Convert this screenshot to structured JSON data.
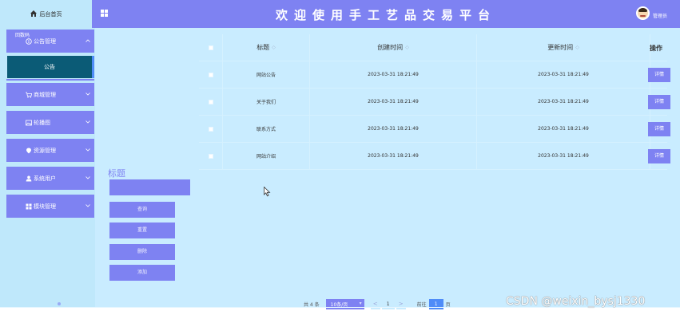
{
  "header": {
    "home_label": "后台首页",
    "title": "欢迎使用手工艺品交易平台",
    "admin_name": "管理员"
  },
  "sidebar": {
    "badge": "回数码",
    "items": [
      {
        "label": "公告管理",
        "icon": "info-circle-icon",
        "arrow": "^"
      },
      {
        "label": "商城管理",
        "icon": "cart-icon",
        "arrow": "v"
      },
      {
        "label": "轮播图",
        "icon": "picture-icon",
        "arrow": "v"
      },
      {
        "label": "资源管理",
        "icon": "location-pin-icon",
        "arrow": "v"
      },
      {
        "label": "系统用户",
        "icon": "user-icon",
        "arrow": "v"
      },
      {
        "label": "模块管理",
        "icon": "grid-icon",
        "arrow": "v"
      }
    ],
    "submenu": {
      "label": "公告"
    }
  },
  "search": {
    "label": "标题",
    "input_value": "",
    "buttons": {
      "query": "查询",
      "reset": "重置",
      "delete": "删除",
      "add": "添加"
    }
  },
  "table": {
    "headers": {
      "title": "标题",
      "created": "创建时间",
      "updated": "更新时间",
      "operation": "操作"
    },
    "sort_glyph": "◇",
    "detail_label": "详情",
    "rows": [
      {
        "title": "网站公告",
        "created": "2023-03-31 18:21:49",
        "updated": "2023-03-31 18:21:49"
      },
      {
        "title": "关于我们",
        "created": "2023-03-31 18:21:49",
        "updated": "2023-03-31 18:21:49"
      },
      {
        "title": "联系方式",
        "created": "2023-03-31 18:21:49",
        "updated": "2023-03-31 18:21:49"
      },
      {
        "title": "网站介绍",
        "created": "2023-03-31 18:21:49",
        "updated": "2023-03-31 18:21:49"
      }
    ]
  },
  "pagination": {
    "total": "共 4 条",
    "page_size": "10条/页",
    "prev": "<",
    "current": "1",
    "next": ">",
    "goto_label": "前往",
    "goto_value": "1",
    "unit": "页"
  },
  "watermark": "CSDN @weixin_bysj1330",
  "colors": {
    "accent": "#7e82f2",
    "sidebar_bg": "#bfe8fb",
    "content_bg": "#c9ecff",
    "active_submenu": "#0b5b76",
    "link_blue": "#4f8cf8"
  }
}
